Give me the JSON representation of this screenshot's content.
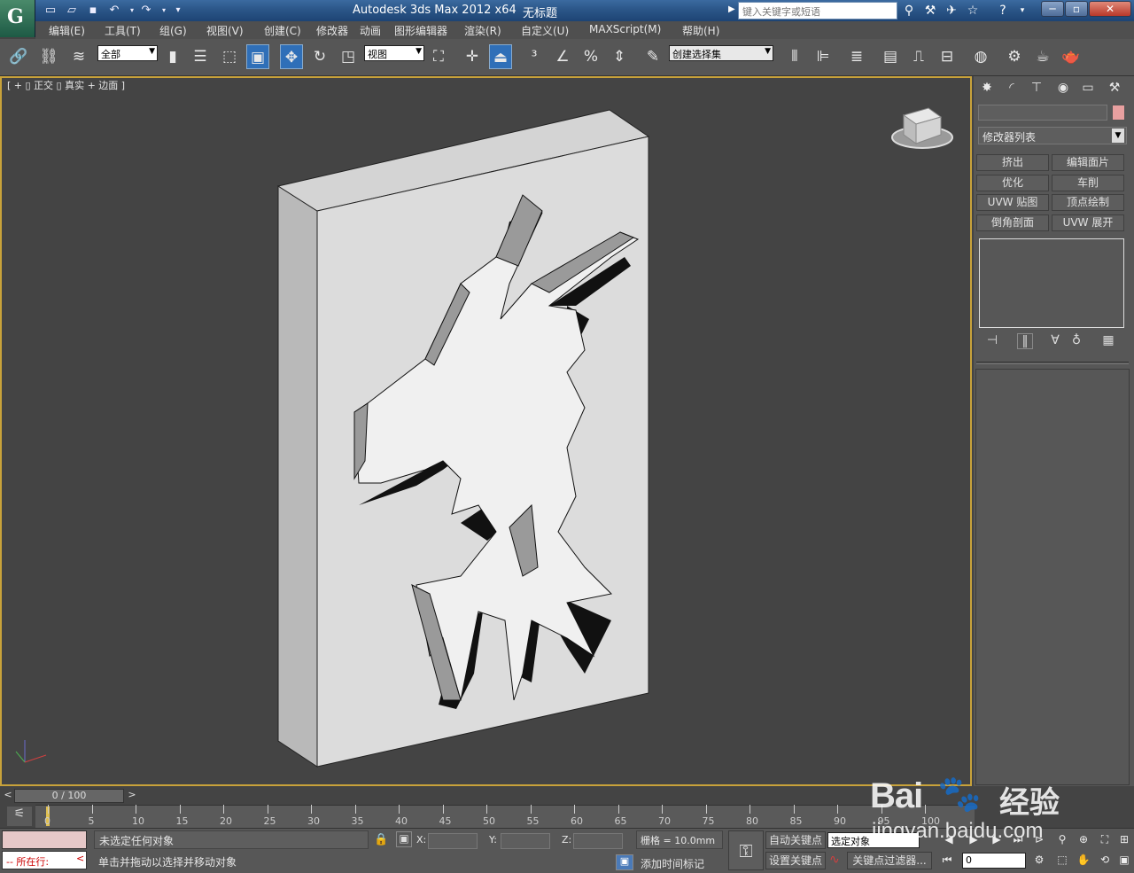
{
  "titlebar": {
    "app_title": "Autodesk 3ds Max  2012 x64",
    "doc_title": "无标题",
    "search_placeholder": "键入关键字或短语"
  },
  "menu": [
    "编辑(E)",
    "工具(T)",
    "组(G)",
    "视图(V)",
    "创建(C)",
    "修改器",
    "动画",
    "图形编辑器",
    "渲染(R)",
    "自定义(U)",
    "MAXScript(M)",
    "帮助(H)"
  ],
  "toolbar": {
    "selection_filter": "全部",
    "ref_coord": "视图",
    "named_selection": "创建选择集"
  },
  "viewport": {
    "label": "[ + ▯ 正交 ▯ 真实 + 边面 ]"
  },
  "command_panel": {
    "modifier_list": "修改器列表",
    "mod_buttons": [
      "挤出",
      "编辑面片",
      "优化",
      "车削",
      "UVW 贴图",
      "顶点绘制",
      "倒角剖面",
      "UVW 展开"
    ]
  },
  "timeline": {
    "slider": "0 / 100",
    "ticks": [
      "0",
      "5",
      "10",
      "15",
      "20",
      "25",
      "30",
      "35",
      "40",
      "45",
      "50",
      "55",
      "60",
      "65",
      "70",
      "75",
      "80",
      "85",
      "90",
      "95",
      "100"
    ]
  },
  "status": {
    "listener_text": "-- 所在行:",
    "selection_info": "未选定任何对象",
    "prompt": "单击并拖动以选择并移动对象",
    "x_label": "X:",
    "y_label": "Y:",
    "z_label": "Z:",
    "grid": "栅格 = 10.0mm",
    "add_time_tag": "添加时间标记",
    "auto_key": "自动关键点",
    "set_key": "设置关键点",
    "key_mode": "选定对象",
    "key_filters": "关键点过滤器...",
    "current_frame": "0"
  },
  "watermark": {
    "brand": "Bai",
    "brand2": "经验",
    "url": "jingyan.baidu.com"
  }
}
